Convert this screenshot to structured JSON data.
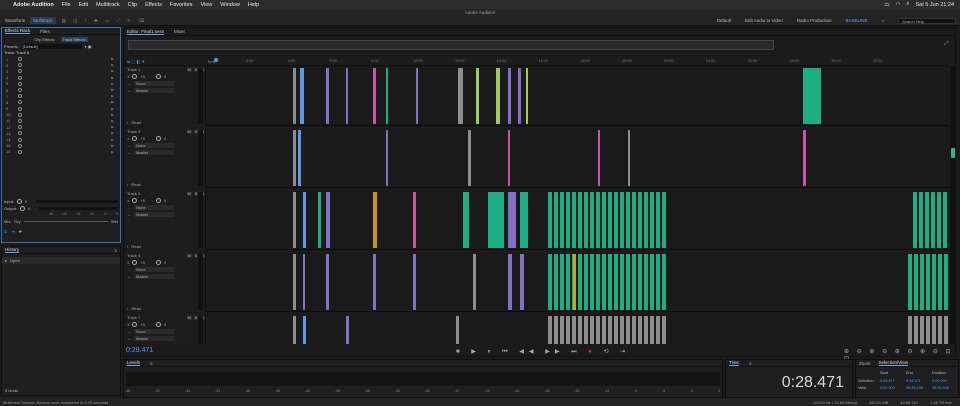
{
  "menubar": {
    "apple": "",
    "app": "Adobe Audition",
    "items": [
      "File",
      "Edit",
      "Multitrack",
      "Clip",
      "Effects",
      "Favorites",
      "View",
      "Window",
      "Help"
    ],
    "datetime": "Sat 5 Jun  21:24"
  },
  "window_title": "Adobe Audition",
  "toolbar": {
    "waveform": "Waveform",
    "multitrack": "Multitrack",
    "workspaces": [
      "Default",
      "Edit Audio to Video",
      "Radio Production"
    ],
    "active_workspace": "BASELINE",
    "search_placeholder": "Search Help"
  },
  "effects_rack": {
    "tabs": [
      "Effects Rack",
      "Files"
    ],
    "subtabs": [
      "Clip Effects",
      "Track Effects"
    ],
    "presets_label": "Presets:",
    "preset_value": "[Default]",
    "track_label": "Track: Track 8",
    "slots": [
      "1",
      "2",
      "3",
      "4",
      "5",
      "6",
      "7",
      "8",
      "9",
      "10",
      "11",
      "12",
      "13",
      "14",
      "15",
      "16"
    ],
    "input_label": "Input:",
    "output_label": "Output:",
    "in_db": "0",
    "out_db": "0",
    "mix_label": "Mix:",
    "dry": "Dry",
    "wet": "Wet",
    "meter_ticks": [
      "dB",
      "-48",
      "-36",
      "-24",
      "-12",
      "0"
    ]
  },
  "history": {
    "title": "History",
    "items": [
      "Open"
    ],
    "undo_count": "0 Undo"
  },
  "editor": {
    "tabs": [
      "Editor: Final1.sesx",
      "Mixer"
    ],
    "ruler_unit": "hms",
    "ruler_ticks": [
      "2:00",
      "4:00",
      "6:00",
      "8:00",
      "10:00",
      "12:00",
      "14:00",
      "16:00",
      "18:00",
      "20:00",
      "22:00",
      "24:00",
      "26:00",
      "28:00",
      "30:00",
      "32:00"
    ],
    "tracks": [
      {
        "name": "Track 1",
        "volume": "+0",
        "pan": "0",
        "input": "None",
        "output": "Master",
        "mode": "Read"
      },
      {
        "name": "Track 2",
        "volume": "+0",
        "pan": "0",
        "input": "None",
        "output": "Master",
        "mode": "Read"
      },
      {
        "name": "Track 3",
        "volume": "+0",
        "pan": "0",
        "input": "None",
        "output": "Master",
        "mode": "Read"
      },
      {
        "name": "Track 4",
        "volume": "+0",
        "pan": "0",
        "input": "None",
        "output": "Master",
        "mode": "Read"
      },
      {
        "name": "Track 7",
        "volume": "+0",
        "pan": "0",
        "input": "None",
        "output": "Master",
        "mode": "Read"
      }
    ],
    "current_time": "0:28.471"
  },
  "levels": {
    "title": "Levels",
    "scale": [
      "dB",
      "-57",
      "-54",
      "-51",
      "-48",
      "-45",
      "-42",
      "-39",
      "-36",
      "-33",
      "-30",
      "-27",
      "-24",
      "-21",
      "-18",
      "-15",
      "-12",
      "-9",
      "-6",
      "-3",
      "0"
    ]
  },
  "time_panel": {
    "title": "Time",
    "value": "0:28.471"
  },
  "selection_view": {
    "tabs": [
      "Zoom",
      "Selection/View"
    ],
    "headers": [
      "Start",
      "End",
      "Duration"
    ],
    "rows": [
      {
        "label": "Selection",
        "start": "0:28.471",
        "end": "0:28.471",
        "duration": "0:00.000"
      },
      {
        "label": "View",
        "start": "0:00.000",
        "end": "35:35.446",
        "duration": "35:35.446"
      }
    ]
  },
  "statusbar": {
    "message": "Multitrack Session Backup save completed in 0.00 seconds",
    "sample_rate": "44100 Hz • 32-bit Mixing",
    "memory": "453.91 MB",
    "duration": "44:58.151",
    "free": "1.98 TB free"
  },
  "colors": {
    "accent": "#4a9cff",
    "clip_green": "#1fbf8f",
    "clip_purple": "#8f7ad8",
    "clip_pink": "#e05ab8",
    "clip_orange": "#e0a020"
  }
}
